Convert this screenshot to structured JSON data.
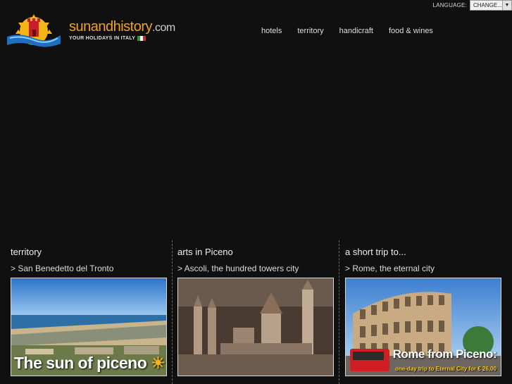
{
  "language": {
    "label": "LANGUAGE:",
    "selected": "CHANGE..."
  },
  "brand": {
    "name_part1": "sunandhistory",
    "name_part2": ".com",
    "tagline": "YOUR HOLIDAYS IN ITALY"
  },
  "nav": [
    {
      "label": "hotels"
    },
    {
      "label": "territory"
    },
    {
      "label": "handicraft"
    },
    {
      "label": "food & wines"
    }
  ],
  "columns": [
    {
      "title": "territory",
      "link": "> San Benedetto del Tronto",
      "image_text": "The sun of piceno"
    },
    {
      "title": "arts in Piceno",
      "link": "> Ascoli, the hundred towers city",
      "image_text": ""
    },
    {
      "title": "a short trip to...",
      "link": "> Rome, the eternal city",
      "image_text": "Rome from Piceno:",
      "image_subtext": "one-day trip to Eternal City for € 26,00"
    }
  ],
  "colors": {
    "accent": "#f0a21e",
    "background": "#101010",
    "flag_green": "#1f9d3a",
    "flag_red": "#d0262d"
  }
}
